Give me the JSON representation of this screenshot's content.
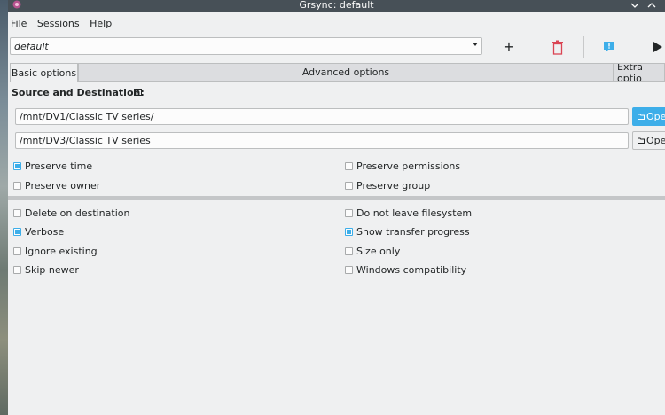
{
  "window": {
    "title": "Grsync: default"
  },
  "menu": {
    "items": [
      "File",
      "Sessions",
      "Help"
    ]
  },
  "session": {
    "selected": "default"
  },
  "toolbar": {
    "add_label": "+"
  },
  "tabs": {
    "basic": "Basic options",
    "advanced": "Advanced options",
    "extra": "Extra optio"
  },
  "section": {
    "title": "Source and Destination:",
    "help_glyph": "?"
  },
  "source": {
    "path": "/mnt/DV1/Classic TV series/",
    "open_label": "Ope"
  },
  "destination": {
    "path": "/mnt/DV3/Classic TV series",
    "open_label": "Ope"
  },
  "options": {
    "preserve_time": {
      "label": "Preserve time",
      "checked": true
    },
    "preserve_permissions": {
      "label": "Preserve permissions",
      "checked": false
    },
    "preserve_owner": {
      "label": "Preserve owner",
      "checked": false
    },
    "preserve_group": {
      "label": "Preserve group",
      "checked": false
    },
    "delete_on_destination": {
      "label": "Delete on destination",
      "checked": false
    },
    "do_not_leave_filesystem": {
      "label": "Do not leave filesystem",
      "checked": false
    },
    "verbose": {
      "label": "Verbose",
      "checked": true
    },
    "show_transfer_progress": {
      "label": "Show transfer progress",
      "checked": true
    },
    "ignore_existing": {
      "label": "Ignore existing",
      "checked": false
    },
    "size_only": {
      "label": "Size only",
      "checked": false
    },
    "skip_newer": {
      "label": "Skip newer",
      "checked": false
    },
    "windows_compatibility": {
      "label": "Windows compatibility",
      "checked": false
    }
  },
  "colors": {
    "accent": "#3daee9",
    "titlebar": "#475057",
    "delete": "#da4453"
  }
}
